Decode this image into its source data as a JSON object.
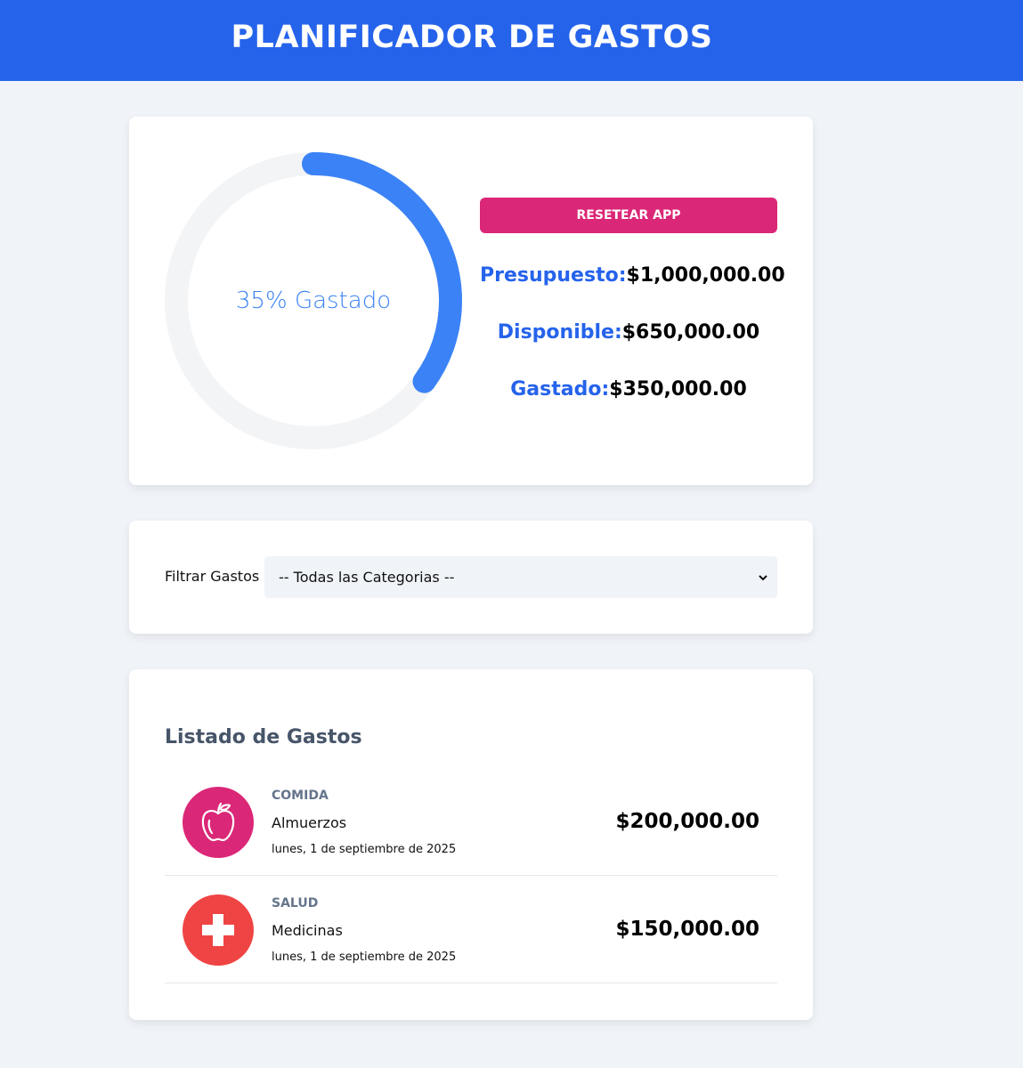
{
  "header": {
    "title": "PLANIFICADOR DE GASTOS"
  },
  "budget": {
    "percent_spent": 35,
    "progress_label": "35% Gastado",
    "reset_label": "RESETEAR APP",
    "presupuesto_label": "Presupuesto:",
    "presupuesto_value": "$1,000,000.00",
    "disponible_label": "Disponible:",
    "disponible_value": "$650,000.00",
    "gastado_label": "Gastado:",
    "gastado_value": "$350,000.00",
    "colors": {
      "progress": "#3b82f6",
      "track": "#f3f4f6",
      "reset": "#db2777"
    }
  },
  "filter": {
    "label": "Filtrar Gastos",
    "selected": "-- Todas las Categorias --"
  },
  "list": {
    "title": "Listado de Gastos",
    "expenses": [
      {
        "category": "COMIDA",
        "name": "Almuerzos",
        "date": "lunes, 1 de septiembre de 2025",
        "amount": "$200,000.00",
        "icon": "apple-icon",
        "color": "#db2777"
      },
      {
        "category": "SALUD",
        "name": "Medicinas",
        "date": "lunes, 1 de septiembre de 2025",
        "amount": "$150,000.00",
        "icon": "medical-cross-icon",
        "color": "#ef4444"
      }
    ]
  }
}
